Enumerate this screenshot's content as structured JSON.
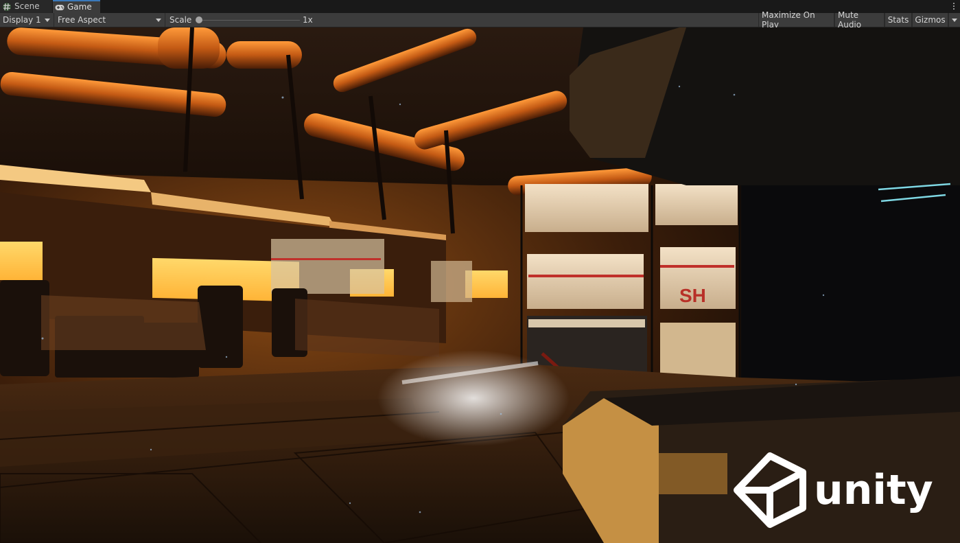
{
  "tabs": [
    {
      "label": "Scene",
      "icon": "scene-hash-icon",
      "active": false
    },
    {
      "label": "Game",
      "icon": "gamepad-icon",
      "active": true
    }
  ],
  "toolbar": {
    "display": {
      "label": "Display 1"
    },
    "aspect": {
      "label": "Free Aspect"
    },
    "scale": {
      "label": "Scale",
      "value": "1x",
      "level": 0.0
    },
    "buttons": {
      "maximize": "Maximize On Play",
      "mute": "Mute Audio",
      "stats": "Stats",
      "gizmos": "Gizmos"
    }
  },
  "viewport": {
    "scene_text": "SH",
    "watermark": "unity"
  },
  "colors": {
    "accent": "#3a79bb",
    "toolbar_bg": "#3c3c3c",
    "tabbar_bg": "#191919",
    "screen_glow": "#ffc24a",
    "stripe_red": "#c0302a"
  }
}
